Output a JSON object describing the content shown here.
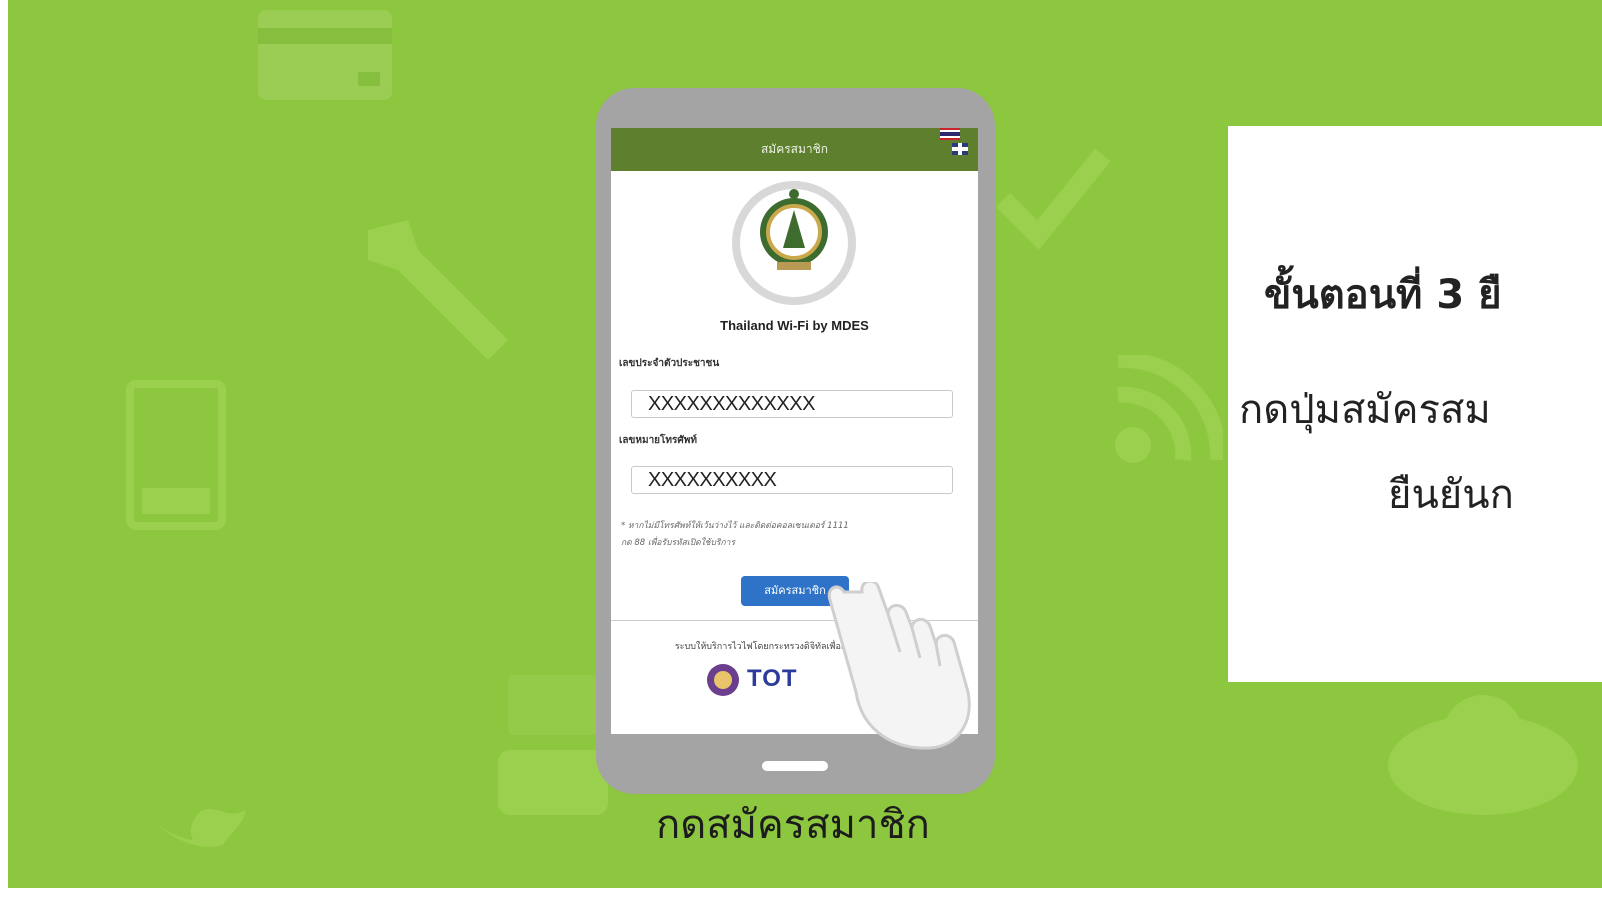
{
  "colors": {
    "background": "#8dc63f",
    "appbar": "#5d7f2e",
    "button": "#2f73c9",
    "phone": "#a4a4a4"
  },
  "app": {
    "header_title": "สมัครสมาชิก",
    "title": "Thailand Wi-Fi by MDES",
    "seal_icon": "mdes-seal-icon",
    "id_label": "เลขประจำตัวประชาชน",
    "id_value": "XXXXXXXXXXXXX",
    "phone_label": "เลขหมายโทรศัพท์",
    "phone_value": "XXXXXXXXXX",
    "note_line1": "* หากไม่มีโทรศัพท์ให้เว้นว่างไว้ และติดต่อคอลเซนเตอร์ 1111",
    "note_line2": "กด 88 เพื่อรับรหัสเปิดใช้บริการ",
    "register_button": "สมัครสมาชิก",
    "footer_text": "ระบบให้บริการไวไฟโดยกระทรวงดิจิทัลเพื่อเศรษฐกิจและสังคม",
    "partner_logo": "TOT"
  },
  "caption": "กดสมัครสมาชิก",
  "step": {
    "title": "ขั้นตอนที่ 3 ยื",
    "desc_line1": "กดปุ่มสมัครสม",
    "desc_line2": "ยืนยันก"
  }
}
